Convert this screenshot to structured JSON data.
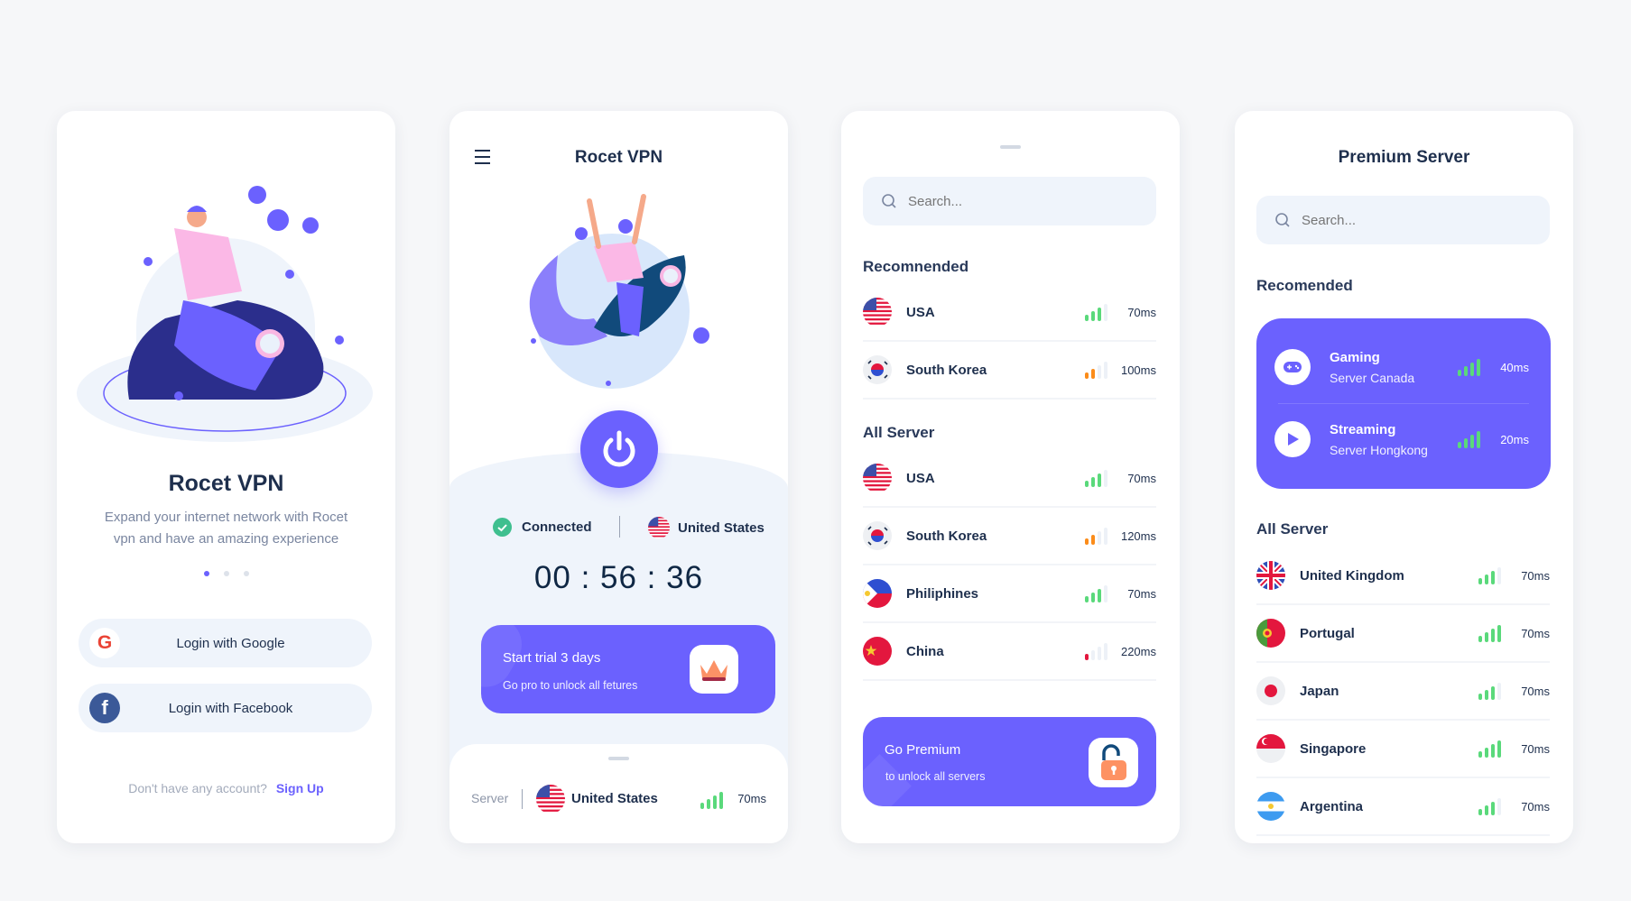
{
  "colors": {
    "accent": "#6b61fe",
    "text": "#1e2f4d",
    "green": "#5ad97b",
    "orange": "#fb8c1a",
    "red": "#e3173e"
  },
  "onboarding": {
    "title": "Rocet VPN",
    "description_line1": "Expand your internet network with Rocet",
    "description_line2": "vpn and have an amazing experience",
    "page_dots": {
      "count": 3,
      "active": 1
    },
    "google_button": "Login with Google",
    "facebook_button": "Login with Facebook",
    "signup_prompt": "Don't have any account?",
    "signup_link": "Sign Up"
  },
  "home": {
    "title": "Rocet VPN",
    "status": "Connected",
    "location": "United States",
    "timer": "00 : 56 : 36",
    "trial": {
      "title": "Start trial 3 days",
      "subtitle": "Go pro to unlock all fetures"
    },
    "server_bar": {
      "label": "Server",
      "country": "United States",
      "latency": "70ms",
      "signal": 4,
      "signal_color": "green"
    }
  },
  "server_list": {
    "search_placeholder": "Search...",
    "recommended_title": "Recomnended",
    "recommended": [
      {
        "country": "USA",
        "flag": "us",
        "signal": 3,
        "signal_color": "green",
        "latency": "70ms"
      },
      {
        "country": "South Korea",
        "flag": "kr",
        "signal": 2,
        "signal_color": "orange",
        "latency": "100ms"
      }
    ],
    "all_title": "All Server",
    "all": [
      {
        "country": "USA",
        "flag": "us",
        "signal": 3,
        "signal_color": "green",
        "latency": "70ms"
      },
      {
        "country": "South Korea",
        "flag": "kr",
        "signal": 2,
        "signal_color": "orange",
        "latency": "120ms"
      },
      {
        "country": "Philiphines",
        "flag": "ph",
        "signal": 3,
        "signal_color": "green",
        "latency": "70ms"
      },
      {
        "country": "China",
        "flag": "cn",
        "signal": 1,
        "signal_color": "red",
        "latency": "220ms"
      }
    ],
    "premium": {
      "title": "Go Premium",
      "subtitle": "to unlock all servers"
    }
  },
  "premium_server": {
    "title": "Premium Server",
    "search_placeholder": "Search...",
    "recommended_title": "Recomended",
    "recommended": [
      {
        "title": "Gaming",
        "subtitle": "Server Canada",
        "icon": "gamepad-icon",
        "signal": 4,
        "latency": "40ms"
      },
      {
        "title": "Streaming",
        "subtitle": "Server Hongkong",
        "icon": "play-icon",
        "signal": 4,
        "latency": "20ms"
      }
    ],
    "all_title": "All Server",
    "all": [
      {
        "country": "United Kingdom",
        "flag": "gb",
        "signal": 3,
        "signal_color": "green",
        "latency": "70ms"
      },
      {
        "country": "Portugal",
        "flag": "pt",
        "signal": 4,
        "signal_color": "green",
        "latency": "70ms"
      },
      {
        "country": "Japan",
        "flag": "jp",
        "signal": 3,
        "signal_color": "green",
        "latency": "70ms"
      },
      {
        "country": "Singapore",
        "flag": "sg",
        "signal": 4,
        "signal_color": "green",
        "latency": "70ms"
      },
      {
        "country": "Argentina",
        "flag": "ar",
        "signal": 3,
        "signal_color": "green",
        "latency": "70ms"
      }
    ]
  }
}
